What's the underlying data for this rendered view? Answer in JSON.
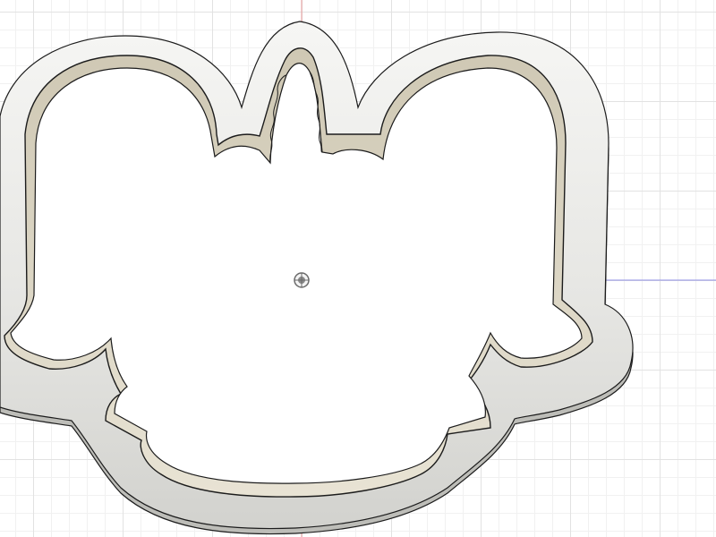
{
  "viewport": {
    "background_color": "#ffffff",
    "grid_major_color": "#e2e2e2",
    "grid_minor_color": "#f1f1f1"
  },
  "axes": {
    "x_axis_color": "#8f8fe6",
    "y_axis_color": "#e89a9a"
  },
  "origin": {
    "icon": "origin-point-icon"
  },
  "model": {
    "name": "cookie-cutter-outline",
    "flange_color": "#ececea",
    "flange_shadow_color": "#cfcfcb",
    "wall_color": "#d9d4c4",
    "edge_color": "#1c1c1c"
  }
}
